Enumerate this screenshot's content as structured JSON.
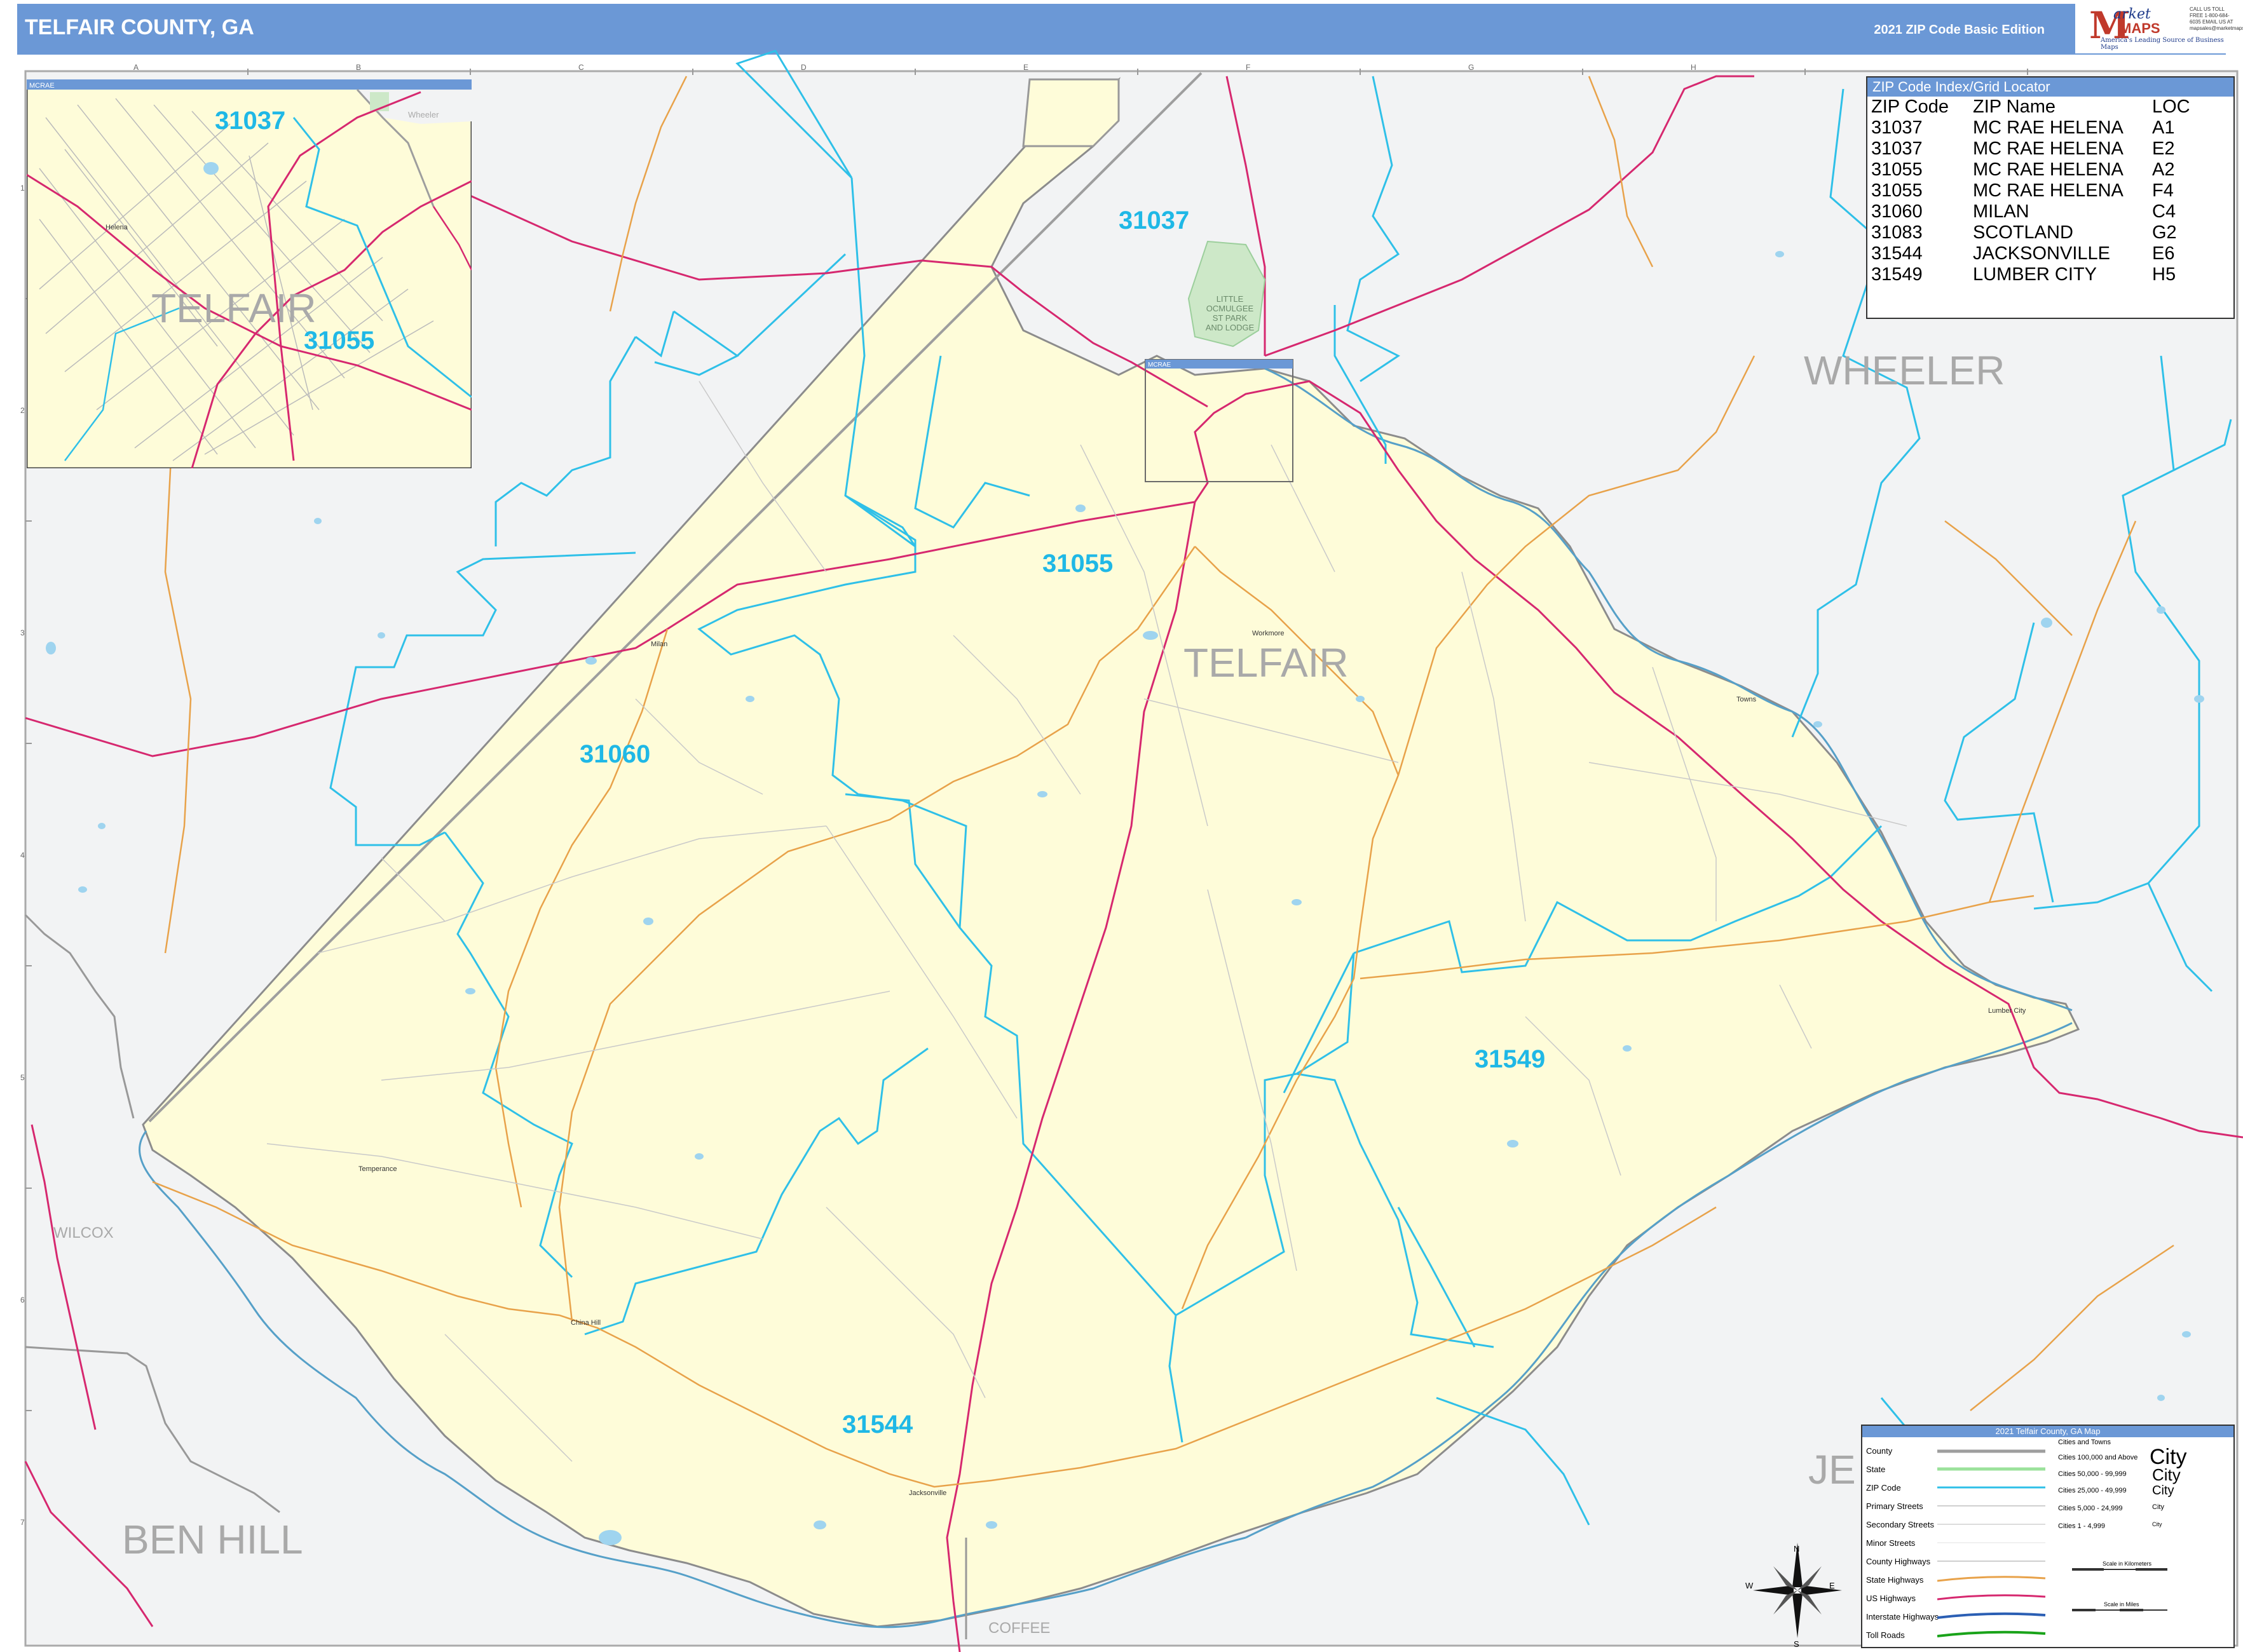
{
  "header": {
    "title": "TELFAIR COUNTY, GA",
    "edition": "2021 ZIP Code Basic Edition",
    "logo": {
      "brand_m": "M",
      "brand_arket": "arket",
      "brand_maps": "MAPS",
      "tagline": "America's Leading Source of Business Maps",
      "contact": "CALL US TOLL FREE 1-800-684-6035 EMAIL US AT mapsales@marketmaps.com"
    }
  },
  "inset": {
    "title": "MCRAE",
    "county_label": "TELFAIR",
    "zips": [
      "31037",
      "31055"
    ],
    "place": "Helena",
    "neighbor": "Wheeler"
  },
  "map": {
    "county_name": "TELFAIR",
    "neighbors": [
      "WHEELER",
      "BEN HILL",
      "WILCOX",
      "COFFEE",
      "JE"
    ],
    "zips": [
      "31037",
      "31055",
      "31060",
      "31549",
      "31544"
    ],
    "places": [
      "Milan",
      "Towns",
      "Lumber City",
      "Temperance",
      "China Hill",
      "Jacksonville",
      "Workmore"
    ],
    "park": [
      "LITTLE",
      "OCMULGEE",
      "ST PARK",
      "AND LODGE"
    ],
    "grid_cols": [
      "A",
      "B",
      "C",
      "D",
      "E",
      "F",
      "G",
      "H"
    ],
    "grid_rows": [
      "1",
      "2",
      "3",
      "4",
      "5",
      "6",
      "7"
    ],
    "inset_box_label": "MCRAE"
  },
  "zip_index": {
    "title": "ZIP Code Index/Grid Locator",
    "headers": [
      "ZIP Code",
      "ZIP Name",
      "LOC"
    ],
    "rows": [
      [
        "31037",
        "MC RAE HELENA",
        "A1"
      ],
      [
        "31037",
        "MC RAE HELENA",
        "E2"
      ],
      [
        "31055",
        "MC RAE HELENA",
        "A2"
      ],
      [
        "31055",
        "MC RAE HELENA",
        "F4"
      ],
      [
        "31060",
        "MILAN",
        "C4"
      ],
      [
        "31083",
        "SCOTLAND",
        "G2"
      ],
      [
        "31544",
        "JACKSONVILLE",
        "E6"
      ],
      [
        "31549",
        "LUMBER CITY",
        "H5"
      ]
    ]
  },
  "legend": {
    "title": "2021 Telfair County, GA Map",
    "items": [
      "County",
      "State",
      "ZIP Code",
      "Primary Streets",
      "Secondary Streets",
      "Minor Streets",
      "County Highways",
      "State Highways",
      "US Highways",
      "Interstate Highways",
      "Toll Roads"
    ],
    "cities_header": "Cities and Towns",
    "city_classes": [
      "Cities 100,000 and Above",
      "Cities 50,000 - 99,999",
      "Cities 25,000 - 49,999",
      "Cities 5,000 - 24,999",
      "Cities 1 - 4,999"
    ],
    "city_samples": [
      "City",
      "City",
      "City",
      "City",
      "City"
    ],
    "scale_km": "Scale in Kilometers",
    "scale_mi": "Scale in Miles",
    "compass": [
      "N",
      "S",
      "E",
      "W"
    ],
    "colors": {
      "county": "#9e9e9e",
      "state": "#9be29b",
      "zip": "#2fc0e8",
      "state_highway": "#e8a24a",
      "us_highway": "#d6286f",
      "interstate": "#2b5fb4",
      "toll": "#1aa31a"
    }
  }
}
